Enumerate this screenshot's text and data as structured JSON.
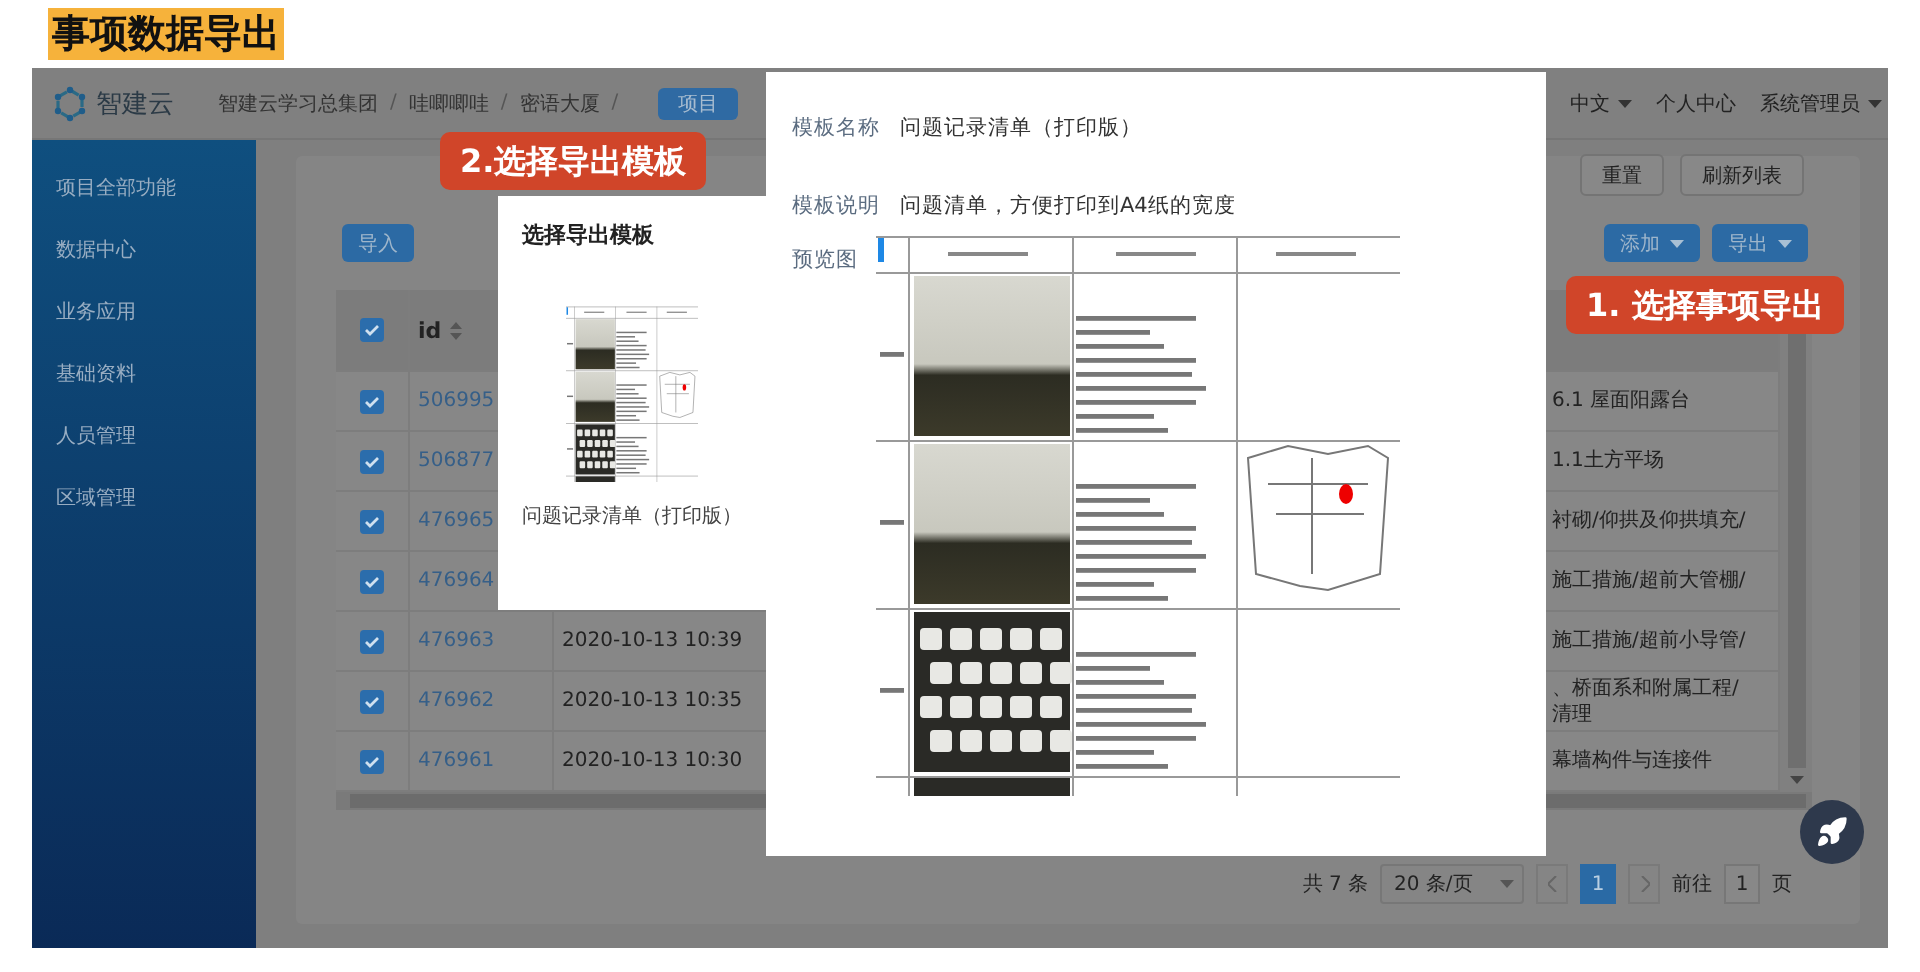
{
  "title": "事项数据导出",
  "header": {
    "logo": "智建云",
    "breadcrumb": [
      {
        "label": "智建云学习总集团",
        "separator": "/"
      },
      {
        "label": "哇唧唧哇",
        "separator": "/"
      },
      {
        "label": "密语大厦",
        "separator": "/"
      }
    ],
    "badge": "项目",
    "links": [
      {
        "label": "中文",
        "dropdown": true
      },
      {
        "label": "个人中心",
        "dropdown": false
      },
      {
        "label": "系统管理员",
        "dropdown": true
      }
    ]
  },
  "sidebar": {
    "items": [
      "项目全部功能",
      "数据中心",
      "业务应用",
      "基础资料",
      "人员管理",
      "区域管理"
    ]
  },
  "toolbar": {
    "top_buttons": [
      "重置",
      "刷新列表"
    ],
    "import_button": "导入",
    "dropdown_buttons": [
      "添加",
      "导出"
    ]
  },
  "table": {
    "header": {
      "checked": true,
      "id_label": "id"
    },
    "rows": [
      {
        "checked": true,
        "id": "506995",
        "time": "",
        "last": [
          "6.1 屋面阳露台"
        ]
      },
      {
        "checked": true,
        "id": "506877",
        "time": "",
        "last": [
          "1.1土方平场"
        ]
      },
      {
        "checked": true,
        "id": "476965",
        "time": "",
        "last": [
          "衬砌/仰拱及仰拱填充/"
        ]
      },
      {
        "checked": true,
        "id": "476964",
        "time": "",
        "last": [
          "施工措施/超前大管棚/"
        ]
      },
      {
        "checked": true,
        "id": "476963",
        "time": "2020-10-13 10:39",
        "last": [
          "施工措施/超前小导管/"
        ]
      },
      {
        "checked": true,
        "id": "476962",
        "time": "2020-10-13 10:35",
        "last": [
          "、桥面系和附属工程/",
          "清理"
        ]
      },
      {
        "checked": true,
        "id": "476961",
        "time": "2020-10-13 10:30",
        "last": [
          "幕墙构件与连接件"
        ]
      }
    ]
  },
  "pagination": {
    "total": "共 7 条",
    "page_size": "20 条/页",
    "pages": [
      {
        "label": "1",
        "selected": true
      }
    ],
    "goto_label": "前往",
    "goto_value": "1",
    "goto_suffix": "页"
  },
  "template_dialog": {
    "title": "选择导出模板",
    "templates": [
      "问题记录清单（打印版）"
    ]
  },
  "preview_dialog": {
    "fields": [
      {
        "label": "模板名称",
        "value": "问题记录清单（打印版）"
      },
      {
        "label": "模板说明",
        "value": "问题清单，方便打印到A4纸的宽度"
      }
    ],
    "preview_label": "预览图"
  },
  "callouts": [
    "2.选择导出模板",
    "1. 选择事项导出"
  ]
}
